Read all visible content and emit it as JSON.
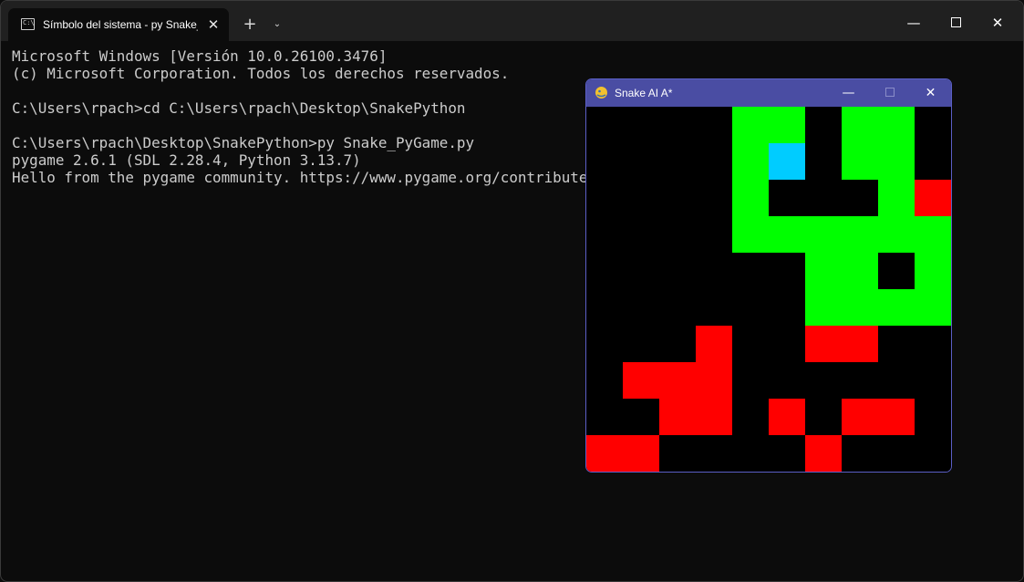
{
  "terminal": {
    "tab_title": "Símbolo del sistema - py  Snake_PyGame.py",
    "tab_icon": "cmd-icon",
    "close_tab_glyph": "✕",
    "new_tab_glyph": "+",
    "dropdown_glyph": "⌄",
    "window_controls": {
      "minimize": "—",
      "close": "✕"
    },
    "lines": [
      "Microsoft Windows [Versión 10.0.26100.3476]",
      "(c) Microsoft Corporation. Todos los derechos reservados.",
      "",
      "C:\\Users\\rpach>cd C:\\Users\\rpach\\Desktop\\SnakePython",
      "",
      "C:\\Users\\rpach\\Desktop\\SnakePython>py Snake_PyGame.py",
      "pygame 2.6.1 (SDL 2.28.4, Python 3.13.7)",
      "Hello from the pygame community. https://www.pygame.org/contribute.html"
    ],
    "colors": {
      "background": "#0c0c0c",
      "text": "#cccccc",
      "titlebar": "#202020"
    }
  },
  "game": {
    "title": "Snake AI A*",
    "icon": "pygame-snake-icon",
    "controls": {
      "minimize": "—",
      "close": "✕"
    },
    "grid": {
      "cols": 10,
      "rows": 10
    },
    "colors": {
      "background": "#000000",
      "snake": "#00ff00",
      "head": "#00ccff",
      "obstacle": "#ff0000",
      "titlebar": "#4a4da3"
    },
    "snake_cells": [
      [
        4,
        0
      ],
      [
        5,
        0
      ],
      [
        7,
        0
      ],
      [
        8,
        0
      ],
      [
        4,
        1
      ],
      [
        7,
        1
      ],
      [
        8,
        1
      ],
      [
        4,
        2
      ],
      [
        8,
        2
      ],
      [
        4,
        3
      ],
      [
        5,
        3
      ],
      [
        6,
        3
      ],
      [
        7,
        3
      ],
      [
        8,
        3
      ],
      [
        9,
        3
      ],
      [
        6,
        4
      ],
      [
        7,
        4
      ],
      [
        9,
        4
      ],
      [
        6,
        5
      ],
      [
        7,
        5
      ],
      [
        8,
        5
      ],
      [
        9,
        5
      ]
    ],
    "head_cell": [
      5,
      1
    ],
    "obstacle_cells": [
      [
        9,
        2
      ],
      [
        3,
        6
      ],
      [
        6,
        6
      ],
      [
        7,
        6
      ],
      [
        1,
        7
      ],
      [
        2,
        7
      ],
      [
        3,
        7
      ],
      [
        2,
        8
      ],
      [
        3,
        8
      ],
      [
        5,
        8
      ],
      [
        7,
        8
      ],
      [
        8,
        8
      ],
      [
        0,
        9
      ],
      [
        1,
        9
      ],
      [
        6,
        9
      ]
    ]
  }
}
